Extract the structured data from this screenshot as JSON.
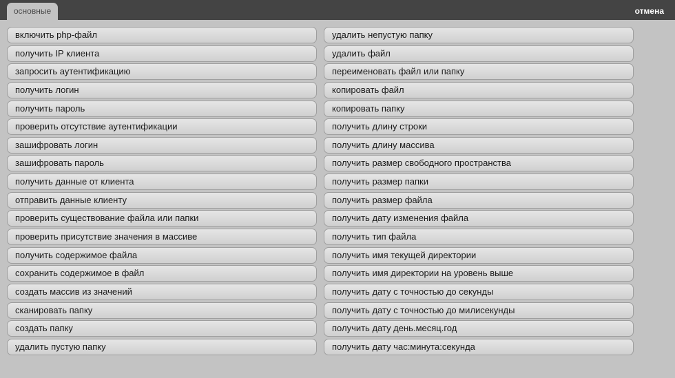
{
  "header": {
    "tab_label": "основные",
    "cancel_label": "отмена"
  },
  "left_items": [
    "включить php-файл",
    "получить IP клиента",
    "запросить аутентификацию",
    "получить логин",
    "получить пароль",
    "проверить отсутствие аутентификации",
    "зашифровать логин",
    "зашифровать пароль",
    "получить данные от клиента",
    "отправить данные клиенту",
    "проверить существование файла или папки",
    "проверить присутствие значения в массиве",
    "получить содержимое файла",
    "сохранить содержимое в файл",
    "создать массив из значений",
    "сканировать папку",
    "создать папку",
    "удалить пустую папку"
  ],
  "right_items": [
    "удалить непустую папку",
    "удалить файл",
    "переименовать файл или папку",
    "копировать файл",
    "копировать папку",
    "получить длину строки",
    "получить длину массива",
    "получить размер свободного пространства",
    "получить размер папки",
    "получить размер файла",
    "получить дату изменения файла",
    "получить тип файла",
    "получить имя текущей директории",
    "получить имя директории на уровень выше",
    "получить дату с точностью до секунды",
    "получить дату с точностью до милисекунды",
    "получить дату день.месяц.год",
    "получить дату час:минута:секунда"
  ]
}
